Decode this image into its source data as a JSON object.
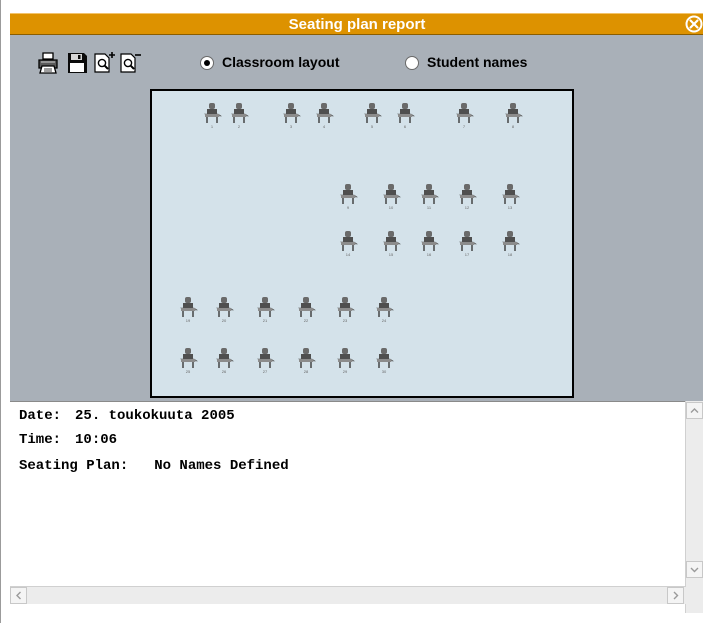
{
  "window": {
    "title": "Seating plan report",
    "accent_color": "#dd9200",
    "close_icon": "close-circle-icon"
  },
  "toolbar": {
    "buttons": [
      {
        "name": "print-button",
        "icon": "printer-icon"
      },
      {
        "name": "save-button",
        "icon": "floppy-disk-icon"
      },
      {
        "name": "zoom-in-button",
        "icon": "zoom-in-icon"
      },
      {
        "name": "zoom-out-button",
        "icon": "zoom-out-icon"
      }
    ],
    "view_options": [
      {
        "label": "Classroom layout",
        "selected": true
      },
      {
        "label": "Student names",
        "selected": false
      }
    ]
  },
  "classroom": {
    "background_color": "#d4e2ea",
    "seats": [
      {
        "num": "1"
      },
      {
        "num": "2"
      },
      {
        "num": "3"
      },
      {
        "num": "4"
      },
      {
        "num": "5"
      },
      {
        "num": "6"
      },
      {
        "num": "7"
      },
      {
        "num": "8"
      },
      {
        "num": "9"
      },
      {
        "num": "10"
      },
      {
        "num": "11"
      },
      {
        "num": "12"
      },
      {
        "num": "13"
      },
      {
        "num": "14"
      },
      {
        "num": "15"
      },
      {
        "num": "16"
      },
      {
        "num": "17"
      },
      {
        "num": "18"
      },
      {
        "num": "19"
      },
      {
        "num": "20"
      },
      {
        "num": "21"
      },
      {
        "num": "22"
      },
      {
        "num": "23"
      },
      {
        "num": "24"
      },
      {
        "num": "25"
      },
      {
        "num": "26"
      },
      {
        "num": "27"
      },
      {
        "num": "28"
      },
      {
        "num": "29"
      },
      {
        "num": "30"
      }
    ]
  },
  "report": {
    "date_label": "Date:",
    "date_value": "25. toukokuuta 2005",
    "time_label": "Time:",
    "time_value": "10:06",
    "plan_label": "Seating Plan:",
    "plan_value": "No Names Defined"
  }
}
